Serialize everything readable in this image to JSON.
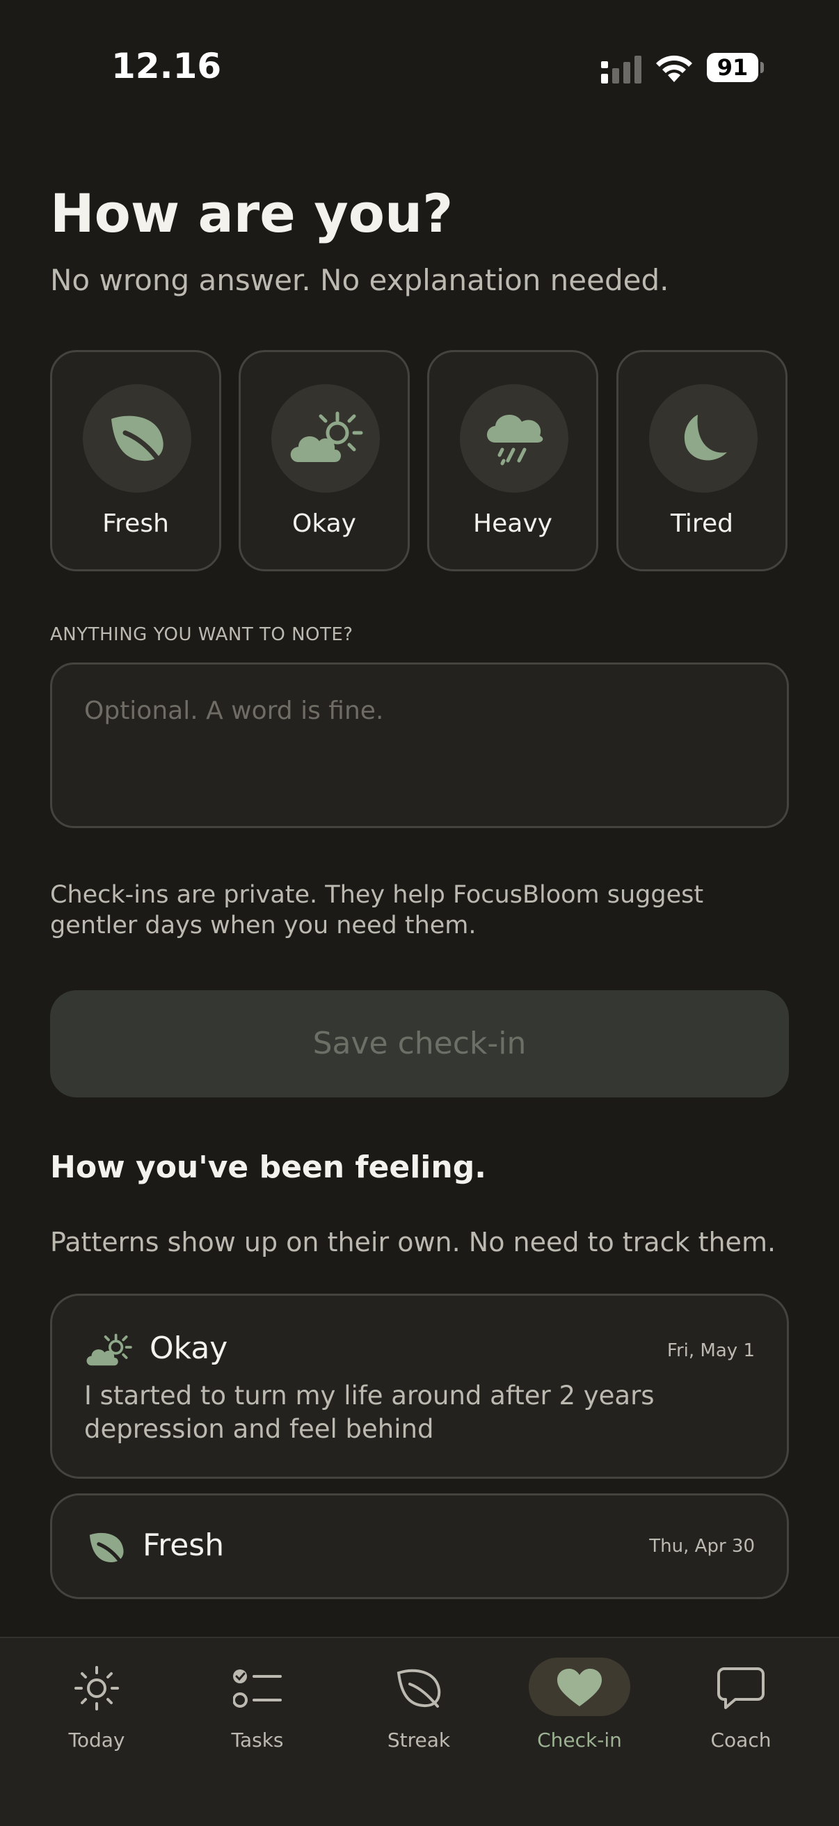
{
  "status_bar": {
    "time": "12.16",
    "battery": "91"
  },
  "header": {
    "title": "How are you?",
    "subtitle": "No wrong answer. No explanation needed."
  },
  "moods": [
    {
      "label": "Fresh",
      "icon": "leaf-icon"
    },
    {
      "label": "Okay",
      "icon": "partly-cloudy-icon"
    },
    {
      "label": "Heavy",
      "icon": "rain-cloud-icon"
    },
    {
      "label": "Tired",
      "icon": "moon-icon"
    }
  ],
  "note": {
    "label": "ANYTHING YOU WANT TO NOTE?",
    "placeholder": "Optional. A word is fine."
  },
  "privacy_text": "Check-ins are private. They help FocusBloom suggest gentler days when you need them.",
  "save_label": "Save check-in",
  "history": {
    "title": "How you've been feeling.",
    "subtitle": "Patterns show up on their own. No need to track them.",
    "entries": [
      {
        "mood": "Okay",
        "icon": "partly-cloudy-icon",
        "date": "Fri, May 1",
        "note": "I started to turn my life around after 2 years depression and feel behind"
      },
      {
        "mood": "Fresh",
        "icon": "leaf-icon",
        "date": "Thu, Apr 30",
        "note": ""
      }
    ]
  },
  "tabs": [
    {
      "label": "Today",
      "icon": "sun-icon",
      "active": false
    },
    {
      "label": "Tasks",
      "icon": "checklist-icon",
      "active": false
    },
    {
      "label": "Streak",
      "icon": "leaf-outline-icon",
      "active": false
    },
    {
      "label": "Check-in",
      "icon": "heart-icon",
      "active": true
    },
    {
      "label": "Coach",
      "icon": "chat-bubble-icon",
      "active": false
    }
  ],
  "colors": {
    "background": "#1b1a17",
    "card": "#24221e",
    "accent_green": "#8fa88a",
    "active_tab_label": "#9cb293"
  }
}
